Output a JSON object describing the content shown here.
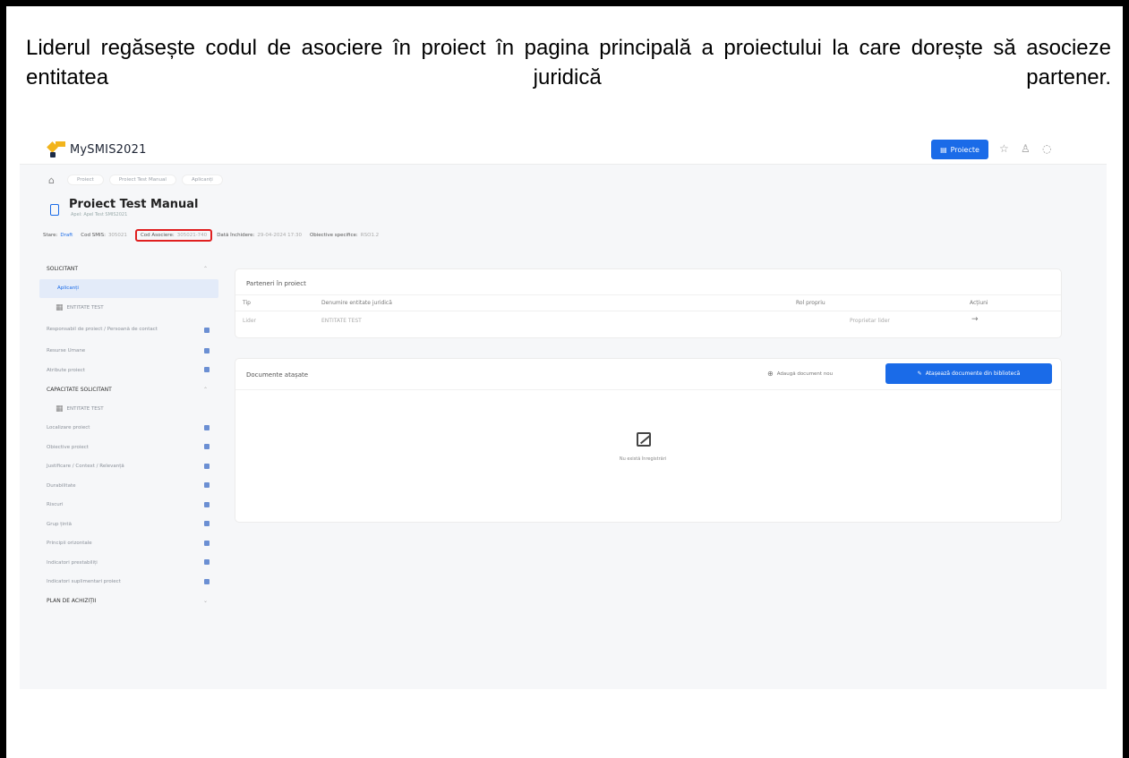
{
  "caption": "Liderul regăsește codul de asociere în proiect în pagina principală a proiectului la care dorește să asocieze entitatea juridică partener.",
  "app": {
    "brand": "MySMIS2021",
    "projects_button": "Proiecte",
    "breadcrumb": [
      "Proiect",
      "Proiect Test Manual",
      "Aplicanți"
    ],
    "project": {
      "title": "Proiect Test Manual",
      "subtitle": "Apel: Apel Test SMIS2021"
    },
    "meta": {
      "status_label": "Stare:",
      "status_value": "Draft",
      "cod_smis_label": "Cod SMIS:",
      "cod_smis_value": "305021",
      "cod_asociere_label": "Cod Asociere:",
      "cod_asociere_value": "305021-740",
      "data_inchidere_label": "Dată închidere:",
      "data_inchidere_value": "29-04-2024 17:30",
      "obiectiv_label": "Obiective specifice:",
      "obiectiv_value": "RSO1.2"
    },
    "sidebar": {
      "solicitant": "SOLICITANT",
      "aplicanti": "Aplicanți",
      "entitate1": "ENTITATE TEST",
      "responsabil": "Responsabil de proiect / Persoană de contact",
      "resurse": "Resurse Umane",
      "atribute": "Atribute proiect",
      "capacitate": "CAPACITATE SOLICITANT",
      "entitate2": "ENTITATE TEST",
      "localizare": "Localizare proiect",
      "obiective": "Obiective proiect",
      "justificare": "Justificare / Context / Relevanță",
      "durabilitate": "Durabilitate",
      "riscuri": "Riscuri",
      "grup": "Grup țintă",
      "principii": "Principii orizontale",
      "indicatori": "Indicatori prestabiliți",
      "indicatori_supl": "Indicatori suplimentari proiect",
      "plan": "PLAN DE ACHIZIȚII"
    },
    "partners": {
      "title": "Parteneri în proiect",
      "headers": {
        "tip": "Tip",
        "denumire": "Denumire entitate juridică",
        "rol": "Rol propriu",
        "actiuni": "Acțiuni"
      },
      "row": {
        "tip": "Lider",
        "denumire": "ENTITATE TEST",
        "rol": "Proprietar lider",
        "actiuni": "→"
      }
    },
    "documents": {
      "title": "Documente atașate",
      "add_label": "Adaugă document nou",
      "attach_label": "Atașează documente din bibliotecă",
      "empty": "Nu există înregistrări"
    }
  }
}
